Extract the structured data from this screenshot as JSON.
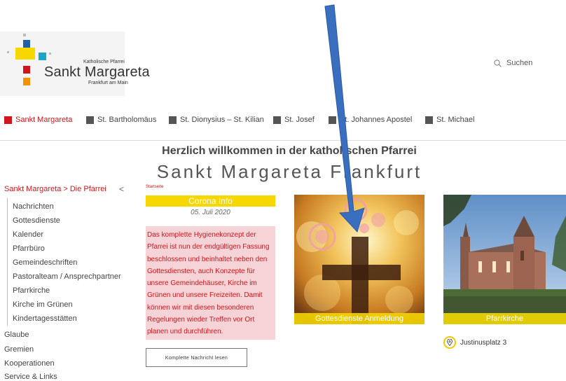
{
  "logo": {
    "small_line1": "Katholische Pfarrei",
    "name": "Sankt Margareta",
    "small_line2": "Frankfurt am Main",
    "colors": {
      "blue": "#1f5faa",
      "yellow": "#f6d800",
      "red": "#d0161c",
      "orange": "#f39200",
      "cyan": "#1aa6c9"
    }
  },
  "search": {
    "label": "Suchen",
    "icon": "search-icon"
  },
  "nav": [
    {
      "label": "Sankt Margareta",
      "active": true
    },
    {
      "label": "St. Bartholomäus"
    },
    {
      "label": "St. Dionysius – St. Kilian"
    },
    {
      "label": "St. Josef"
    },
    {
      "label": "St. Johannes Apostel"
    },
    {
      "label": "St. Michael"
    }
  ],
  "heading": {
    "line1": "Herzlich willkommen in der katholischen Pfarrei",
    "line2": "Sankt Margareta Frankfurt"
  },
  "sidebar": {
    "breadcrumb": "Sankt Margareta > Die Pfarrei",
    "collapse_icon": "chevron-left-icon",
    "sub_items": [
      "Nachrichten",
      "Gottesdienste",
      "Kalender",
      "Pfarrbüro",
      "Gemeindeschriften",
      "Pastoralteam / Ansprechpartner",
      "Pfarrkirche",
      "Kirche im Grünen",
      "Kindertagesstätten"
    ],
    "top_items": [
      "Glaube",
      "Gremien",
      "Kooperationen",
      "Service & Links"
    ]
  },
  "news": {
    "breadcrumb": "Startseite",
    "title": "Corona Info",
    "date": "05. Juli 2020",
    "lines": [
      "Das komplette Hygienekonzept der",
      "Pfarrei ist nun der endgültigen Fassung",
      "beschlossen und beinhaltet neben den",
      "Gottesdiensten, auch Konzepte für",
      "unsere Gemeindehäuser, Kirche im",
      "Grünen und unsere Freizeiten. Damit",
      "können wir mit diesen besonderen",
      "Regelungen wieder Treffen vor Ort",
      "planen und durchführen."
    ],
    "button": "Komplette Nachricht lesen"
  },
  "tiles": {
    "worship": "Gottesdienste Anmeldung",
    "church": "Pfarrkirche"
  },
  "location": {
    "address": "Justinusplatz 3",
    "icon": "location-pin-icon"
  },
  "annotation": {
    "type": "arrow",
    "color": "#3a6fc0"
  }
}
